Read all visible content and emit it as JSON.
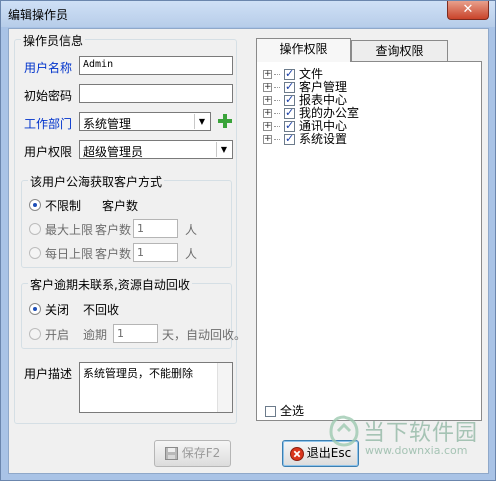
{
  "window": {
    "title": "编辑操作员",
    "close_label": "✕"
  },
  "operator_info": {
    "legend": "操作员信息",
    "username_label": "用户名称",
    "username_value": "Admin",
    "password_label": "初始密码",
    "password_value": "",
    "dept_label": "工作部门",
    "dept_value": "系统管理",
    "add_dept_icon": "plus-icon",
    "rights_label": "用户权限",
    "rights_value": "超级管理员"
  },
  "acquire_group": {
    "legend": "该用户公海获取客户方式",
    "unlimited_label": "不限制",
    "unlimited_suffix": "客户数",
    "max_label": "最大上限",
    "max_count_label": "客户数",
    "max_value": "1",
    "max_unit": "人",
    "daily_label": "每日上限",
    "daily_count_label": "客户数",
    "daily_value": "1",
    "daily_unit": "人"
  },
  "recycle_group": {
    "legend": "客户逾期未联系,资源自动回收",
    "off_label": "关闭",
    "off_suffix": "不回收",
    "on_label": "开启",
    "overdue_label": "逾期",
    "overdue_value": "1",
    "overdue_suffix": "天，自动回收。"
  },
  "description": {
    "label": "用户描述",
    "value": "系统管理员，不能删除"
  },
  "tabs": [
    {
      "label": "操作权限"
    },
    {
      "label": "查询权限"
    }
  ],
  "tree": [
    {
      "label": "文件"
    },
    {
      "label": "客户管理"
    },
    {
      "label": "报表中心"
    },
    {
      "label": "我的办公室"
    },
    {
      "label": "通讯中心"
    },
    {
      "label": "系统设置"
    }
  ],
  "select_all": "全选",
  "buttons": {
    "save": "保存F2",
    "exit": "退出Esc"
  },
  "watermark": {
    "brand": "当下软件园",
    "url": "www.downxia.com"
  },
  "colors": {
    "frame": "#a9c3e6",
    "accent_blue": "#0033cc",
    "close_red": "#c9432a",
    "plus_green": "#3aa33a"
  }
}
